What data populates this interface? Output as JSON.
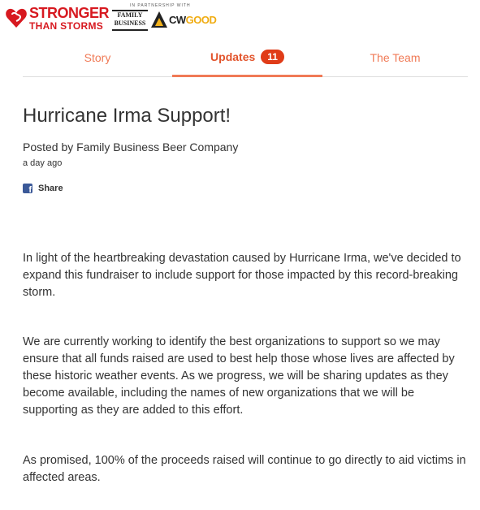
{
  "brand": {
    "line1": "STRONGER",
    "line2": "THAN STORMS",
    "partner_caption": "IN PARTNERSHIP WITH",
    "family_business_line1": "FAMILY",
    "family_business_line2": "BUSINESS",
    "cw_text_a": "CW",
    "cw_text_b": "GOOD",
    "accent_color": "#d71920"
  },
  "tabs": {
    "story_label": "Story",
    "updates_label": "Updates",
    "updates_count": "11",
    "team_label": "The Team",
    "active": "Updates",
    "accent_color": "#f07a56"
  },
  "update": {
    "title": "Hurricane Irma Support!",
    "posted_by": "Posted by Family Business Beer Company",
    "time_ago": "a day ago",
    "share_label": "Share",
    "share_icon": "facebook-icon",
    "paragraphs": [
      "In light of the heartbreaking devastation caused by Hurricane Irma, we've decided to expand this fundraiser to include support for those impacted by this record-breaking storm.",
      "We are currently working to identify the best organizations to support so we may ensure that all funds raised are used to best help those whose lives are affected by these historic weather events.  As we progress, we will be sharing updates as they become available, including the names of new organizations that we will be supporting as they are added to this effort.",
      "As promised, 100% of the proceeds raised will continue to go directly to aid victims in affected areas."
    ]
  }
}
